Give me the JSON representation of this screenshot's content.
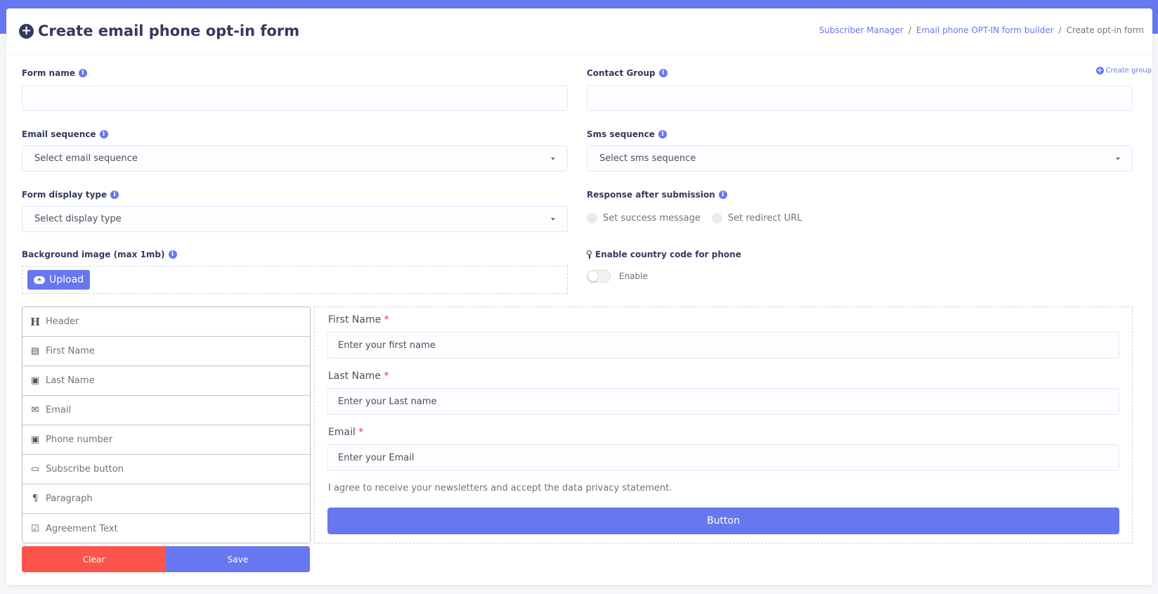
{
  "header": {
    "title": "Create email phone opt-in form",
    "breadcrumb": [
      "Subscriber Manager",
      "Email phone OPT-IN form builder",
      "Create opt-in form"
    ]
  },
  "form": {
    "form_name": {
      "label": "Form name",
      "value": ""
    },
    "contact_group": {
      "label": "Contact Group",
      "value": "",
      "create_link": "Create group"
    },
    "email_sequence": {
      "label": "Email sequence",
      "selected": "Select email sequence"
    },
    "sms_sequence": {
      "label": "Sms sequence",
      "selected": "Select sms sequence"
    },
    "display_type": {
      "label": "Form display type",
      "selected": "Select display type"
    },
    "response": {
      "label": "Response after submission",
      "options": [
        "Set success message",
        "Set redirect URL"
      ]
    },
    "background": {
      "label": "Background image (max 1mb)",
      "upload_label": "Upload"
    },
    "country_code": {
      "label": "Enable country code for phone",
      "toggle_label": "Enable",
      "enabled": false
    }
  },
  "palette": {
    "items": [
      {
        "label": "Header",
        "icon": "heading-icon"
      },
      {
        "label": "First Name",
        "icon": "id-card-icon"
      },
      {
        "label": "Last Name",
        "icon": "clipboard-icon"
      },
      {
        "label": "Email",
        "icon": "envelope-icon"
      },
      {
        "label": "Phone number",
        "icon": "clipboard-icon"
      },
      {
        "label": "Subscribe button",
        "icon": "comment-icon"
      },
      {
        "label": "Paragraph",
        "icon": "paragraph-icon"
      },
      {
        "label": "Agreement Text",
        "icon": "checkbox-icon"
      }
    ]
  },
  "actions": {
    "clear_label": "Clear",
    "save_label": "Save"
  },
  "preview": {
    "first_name": {
      "label": "First Name",
      "required_mark": "*",
      "placeholder": "Enter your first name"
    },
    "last_name": {
      "label": "Last Name",
      "required_mark": "*",
      "placeholder": "Enter your Last name"
    },
    "email": {
      "label": "Email",
      "required_mark": "*",
      "placeholder": "Enter your Email"
    },
    "agreement": "I agree to receive your newsletters and accept the data privacy statement.",
    "button_label": "Button"
  },
  "colors": {
    "primary": "#6777ef",
    "danger": "#fc544b",
    "text": "#34395e"
  }
}
